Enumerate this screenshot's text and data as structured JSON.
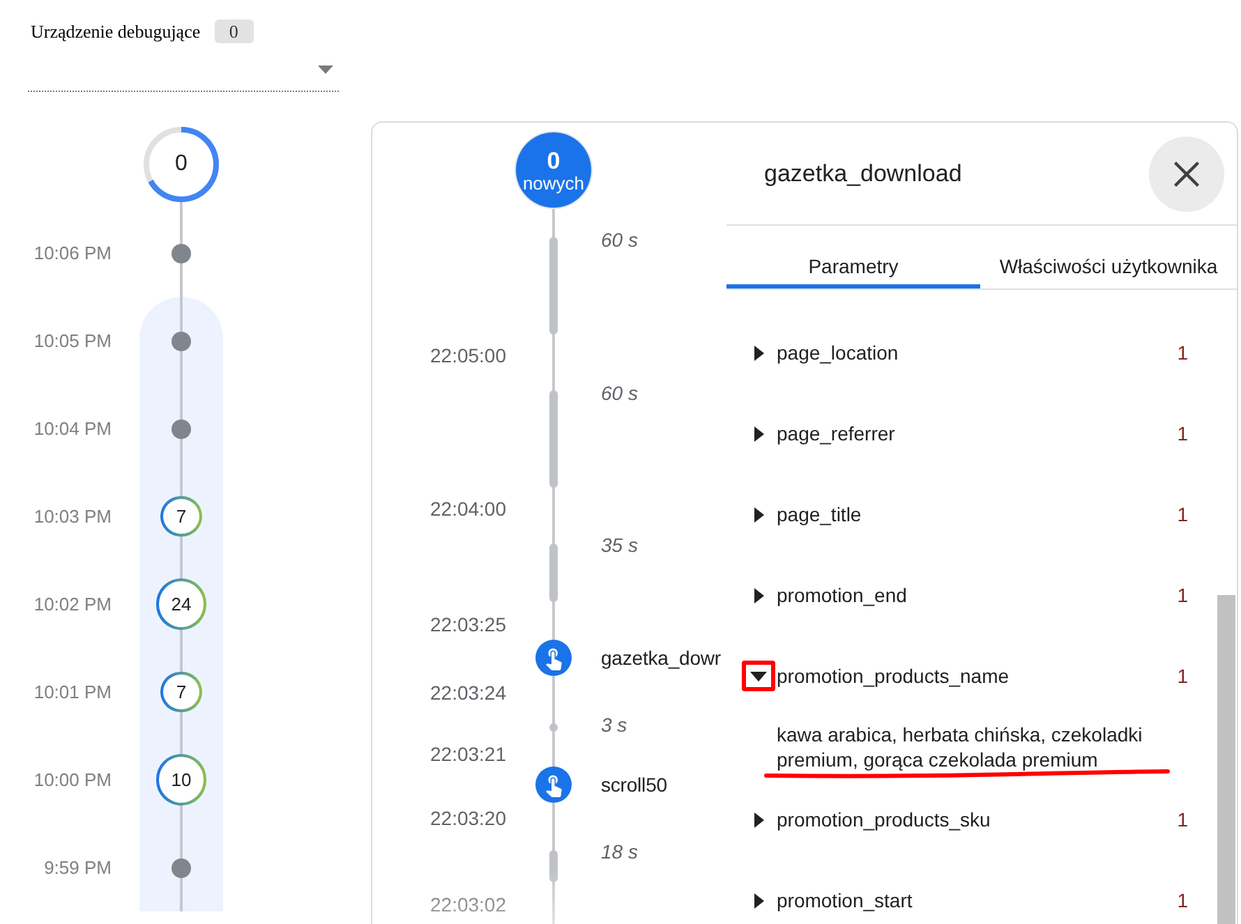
{
  "device": {
    "label": "Urządzenie debugujące",
    "count": "0"
  },
  "countdown": {
    "value": "0",
    "level": 0.67
  },
  "minutes": [
    {
      "time": "10:06 PM",
      "kind": "dot",
      "selected": false
    },
    {
      "time": "10:05 PM",
      "kind": "dot",
      "selected": true
    },
    {
      "time": "10:04 PM",
      "kind": "dot",
      "selected": true
    },
    {
      "time": "10:03 PM",
      "kind": "count",
      "count": "7",
      "selected": true
    },
    {
      "time": "10:02 PM",
      "kind": "count",
      "count": "24",
      "selected": true
    },
    {
      "time": "10:01 PM",
      "kind": "count",
      "count": "7",
      "selected": true
    },
    {
      "time": "10:00 PM",
      "kind": "count",
      "count": "10",
      "selected": true
    },
    {
      "time": "9:59 PM",
      "kind": "dot",
      "selected": true
    }
  ],
  "seconds_stream": {
    "new_events": {
      "count": "0",
      "label": "nowych"
    },
    "entries": [
      {
        "kind": "gap",
        "duration": "60 s"
      },
      {
        "kind": "time",
        "time": "22:05:00"
      },
      {
        "kind": "gap",
        "duration": "60 s"
      },
      {
        "kind": "time",
        "time": "22:04:00"
      },
      {
        "kind": "gap",
        "duration": "35 s"
      },
      {
        "kind": "time",
        "time": "22:03:25"
      },
      {
        "kind": "event",
        "name": "gazetka_dowr"
      },
      {
        "kind": "time",
        "time": "22:03:24"
      },
      {
        "kind": "gap",
        "duration": "3 s"
      },
      {
        "kind": "time",
        "time": "22:03:21"
      },
      {
        "kind": "event",
        "name": "scroll50"
      },
      {
        "kind": "time",
        "time": "22:03:20"
      },
      {
        "kind": "gap",
        "duration": "18 s"
      },
      {
        "kind": "time",
        "time": "22:03:02"
      }
    ]
  },
  "details": {
    "title": "gazetka_download",
    "tabs": [
      {
        "label": "Parametry",
        "selected": true
      },
      {
        "label": "Właściwości użytkownika",
        "selected": false
      }
    ],
    "parameters": [
      {
        "name": "page_location",
        "count": "1",
        "expanded": false,
        "annotated": false
      },
      {
        "name": "page_referrer",
        "count": "1",
        "expanded": false,
        "annotated": false
      },
      {
        "name": "page_title",
        "count": "1",
        "expanded": false,
        "annotated": false
      },
      {
        "name": "promotion_end",
        "count": "1",
        "expanded": false,
        "annotated": false
      },
      {
        "name": "promotion_products_name",
        "count": "1",
        "expanded": true,
        "annotated": true,
        "value": "kawa arabica, herbata chińska, czekoladki premium, gorąca czekolada premium"
      },
      {
        "name": "promotion_products_sku",
        "count": "1",
        "expanded": false,
        "annotated": false
      },
      {
        "name": "promotion_start",
        "count": "1",
        "expanded": false,
        "annotated": false
      }
    ]
  }
}
